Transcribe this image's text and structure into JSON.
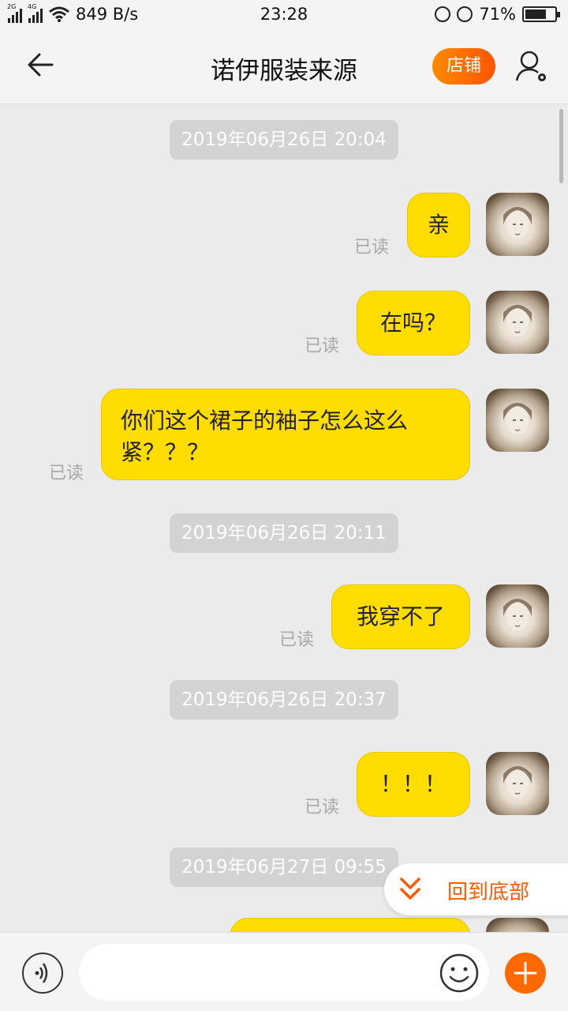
{
  "status_bar": {
    "net1": "2G",
    "net2": "4G",
    "speed": "849 B/s",
    "time": "23:28",
    "battery": "71%",
    "battery_level": 0.71
  },
  "header": {
    "title": "诺伊服装来源",
    "shop_button": "店铺"
  },
  "messages": {
    "ts1": "2019年06月26日 20:04",
    "m1": "亲",
    "m2": "在吗？",
    "m3": "你们这个裙子的袖子怎么这么紧？？？",
    "ts2": "2019年06月26日 20:11",
    "m4": "我穿不了",
    "ts3": "2019年06月26日 20:37",
    "m5": "！！！",
    "ts4": "2019年06月27日 09:55",
    "read": "已读"
  },
  "back_to_bottom": "回到底部",
  "input": {
    "placeholder": ""
  },
  "colors": {
    "bubble": "#ffdd00",
    "accent": "#ff6a00",
    "background": "#ebebeb"
  },
  "icons": [
    "back-arrow-icon",
    "signal-icon",
    "wifi-icon",
    "lock-rotation-icon",
    "alarm-icon",
    "battery-icon",
    "user-settings-icon",
    "double-chevron-down-icon",
    "voice-icon",
    "emoji-icon",
    "plus-icon"
  ]
}
